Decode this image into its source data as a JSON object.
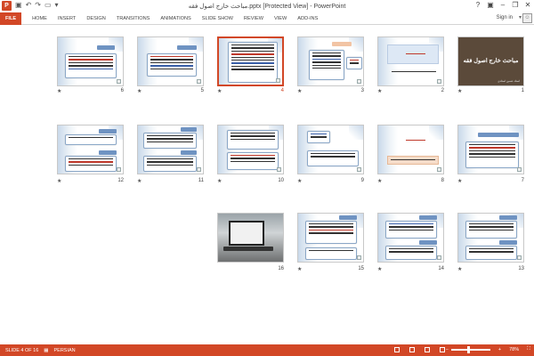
{
  "window": {
    "title": "مباحث خارج اصول فقه.pptx [Protected View] - PowerPoint",
    "app_logo": "P",
    "signin": "Sign in"
  },
  "ribbon": {
    "tabs": [
      "FILE",
      "HOME",
      "INSERT",
      "DESIGN",
      "TRANSITIONS",
      "ANIMATIONS",
      "SLIDE SHOW",
      "REVIEW",
      "VIEW",
      "ADD-INS"
    ]
  },
  "slides": [
    {
      "num": "1",
      "star": "★",
      "title": "مباحث خارج اصول فقه",
      "subtitle": "استاد حسین استادی"
    },
    {
      "num": "2",
      "star": "★"
    },
    {
      "num": "3",
      "star": "★"
    },
    {
      "num": "4",
      "star": "★",
      "selected": true
    },
    {
      "num": "5",
      "star": "★"
    },
    {
      "num": "6",
      "star": "★"
    },
    {
      "num": "7",
      "star": "★"
    },
    {
      "num": "8",
      "star": "★"
    },
    {
      "num": "9",
      "star": "★"
    },
    {
      "num": "10",
      "star": "★"
    },
    {
      "num": "11",
      "star": "★"
    },
    {
      "num": "12",
      "star": "★"
    },
    {
      "num": "13",
      "star": "★"
    },
    {
      "num": "14",
      "star": "★"
    },
    {
      "num": "15",
      "star": "★"
    },
    {
      "num": "16",
      "star": ""
    }
  ],
  "status": {
    "slide_info": "SLIDE 4 OF 16",
    "language": "PERSIAN",
    "zoom": "78%",
    "zoom_minus": "−",
    "zoom_plus": "+"
  },
  "icons": {
    "save": "save-icon",
    "undo": "undo-icon",
    "redo": "redo-icon",
    "present": "present-icon"
  }
}
